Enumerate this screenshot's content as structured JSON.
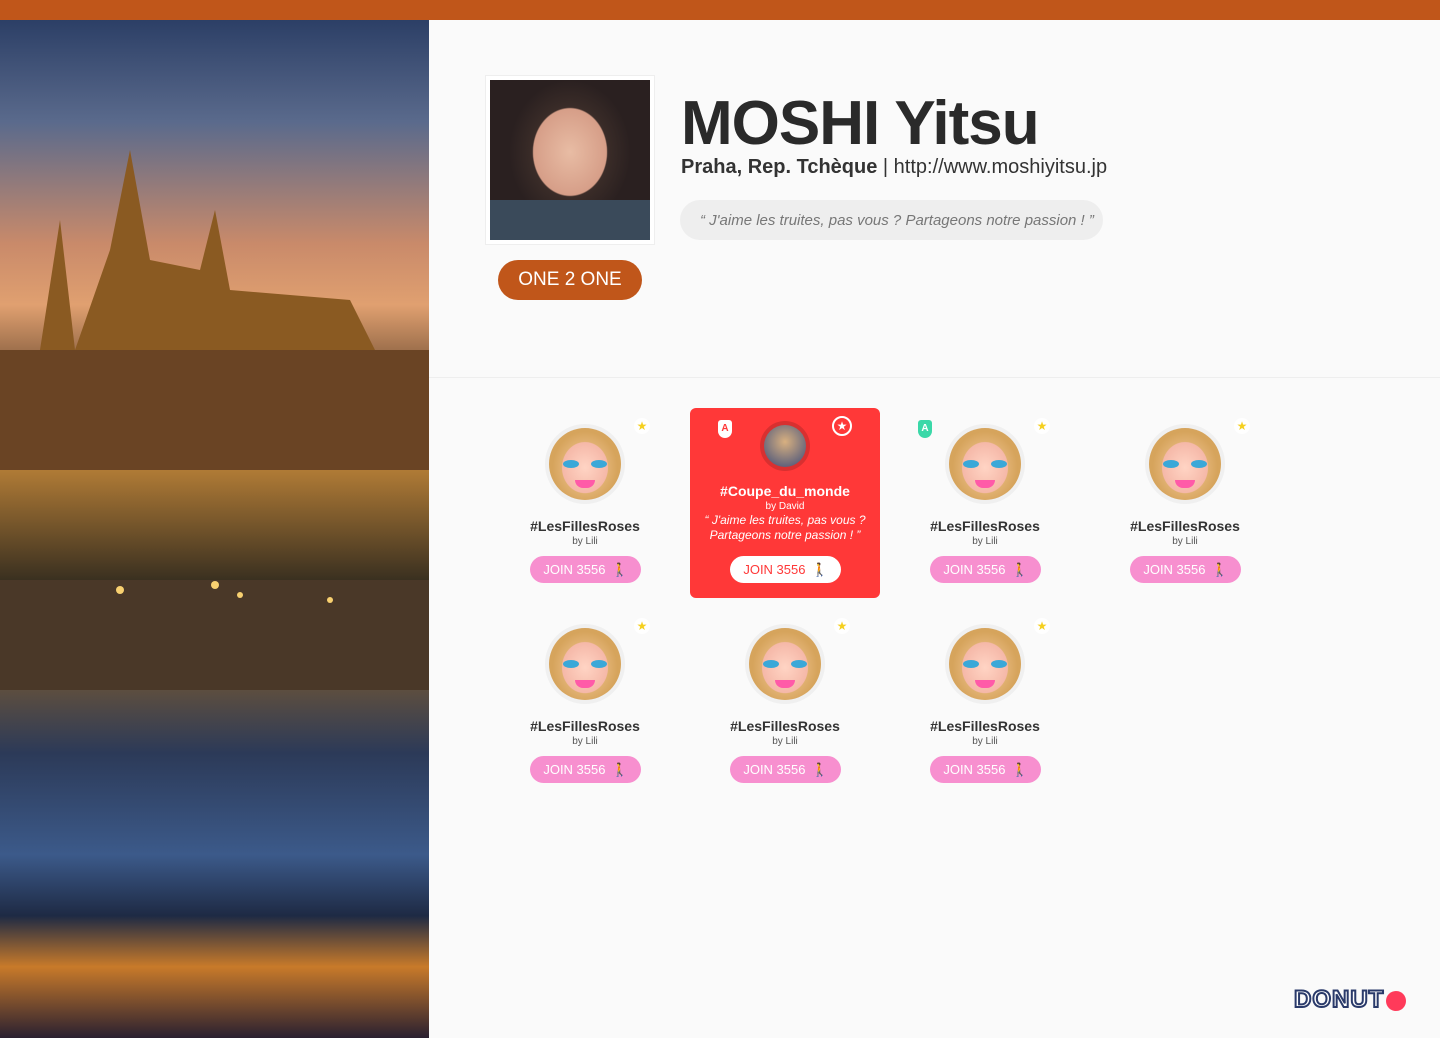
{
  "profile": {
    "name": "MOSHI Yitsu",
    "location": "Praha, Rep. Tchèque",
    "separator": " | ",
    "website": "http://www.moshiyitsu.jp",
    "quote": "“ J'aime les truites, pas vous ? Partageons notre passion ! ”",
    "one2one_label": "ONE 2 ONE"
  },
  "colors": {
    "brand": "#c0561a",
    "highlight": "#ff3838",
    "join": "#f78fcf"
  },
  "groups": [
    {
      "title": "#LesFillesRoses",
      "by": "by Lili",
      "join": "JOIN 3556",
      "icon": "star-icon"
    },
    {
      "title": "#Coupe_du_monde",
      "by": "by David",
      "quote": "“ J'aime les truites, pas vous ? Partageons notre passion ! ”",
      "join": "JOIN 3556",
      "highlighted": true,
      "badge": "A",
      "icon": "star-circle-icon"
    },
    {
      "title": "#LesFillesRoses",
      "by": "by Lili",
      "join": "JOIN 3556",
      "badge": "A",
      "icon": "star-icon"
    },
    {
      "title": "#LesFillesRoses",
      "by": "by Lili",
      "join": "JOIN 3556",
      "icon": "star-icon"
    },
    {
      "title": "#LesFillesRoses",
      "by": "by Lili",
      "join": "JOIN 3556",
      "icon": "star-icon"
    },
    {
      "title": "#LesFillesRoses",
      "by": "by Lili",
      "join": "JOIN 3556",
      "icon": "star-icon"
    },
    {
      "title": "#LesFillesRoses",
      "by": "by Lili",
      "join": "JOIN 3556",
      "icon": "star-icon"
    }
  ],
  "logo": "DONUT"
}
